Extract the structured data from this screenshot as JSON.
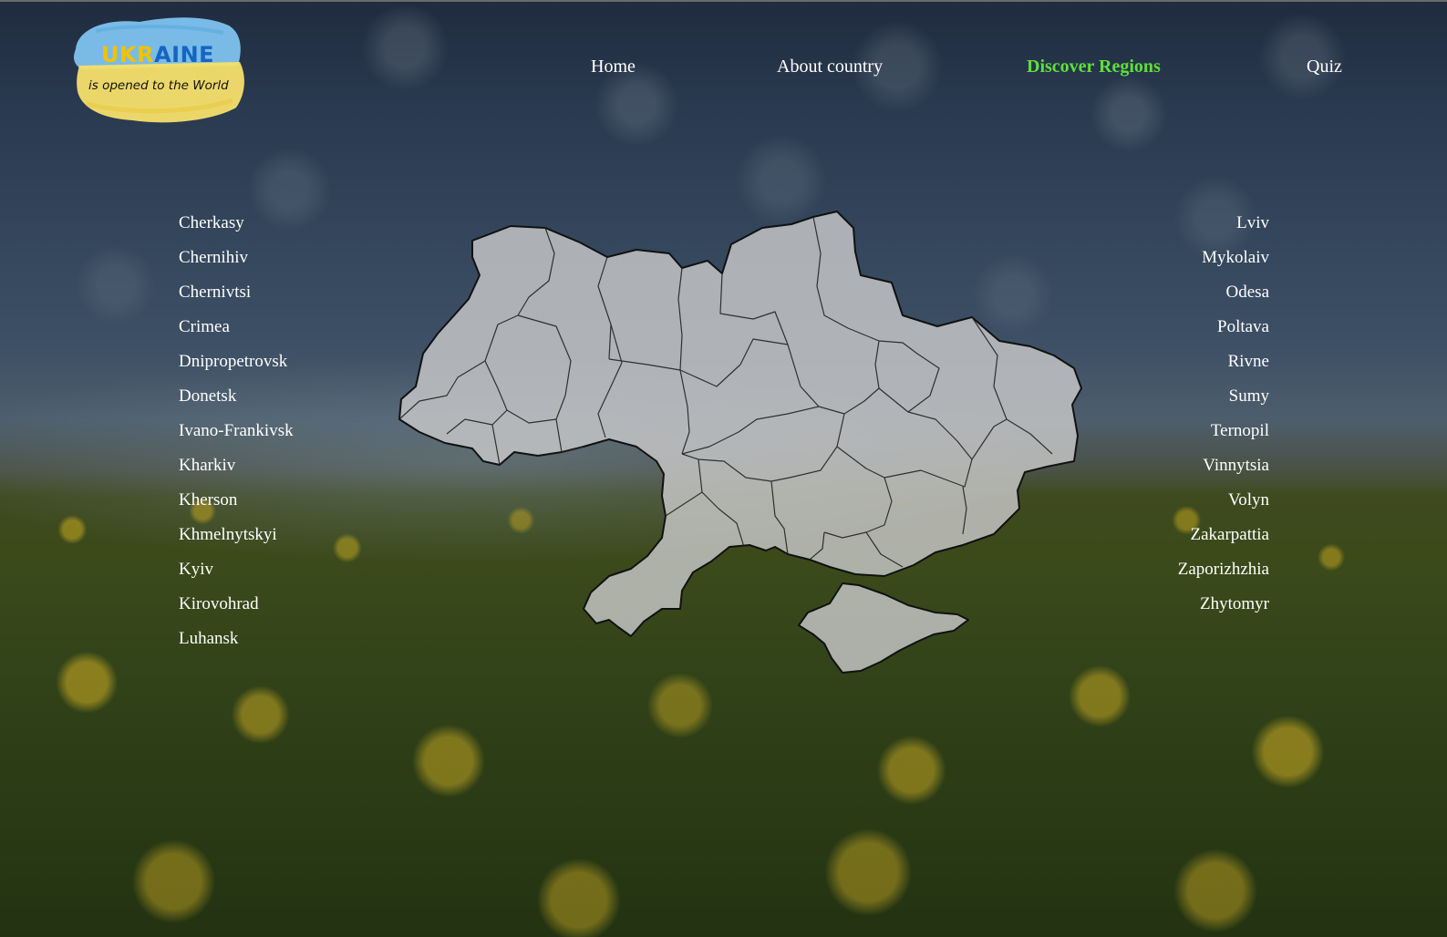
{
  "logo": {
    "title_blue": "UKR",
    "title_rest": "AINE",
    "tagline": "is opened to the World"
  },
  "nav": {
    "items": [
      {
        "label": "Home",
        "active": false
      },
      {
        "label": "About country",
        "active": false
      },
      {
        "label": "Discover Regions",
        "active": true
      },
      {
        "label": "Quiz",
        "active": false
      }
    ],
    "active_color": "#5ee03a"
  },
  "regions": {
    "left": [
      "Cherkasy",
      "Chernihiv",
      "Chernivtsi",
      "Crimea",
      "Dnipropetrovsk",
      "Donetsk",
      "Ivano-Frankivsk",
      "Kharkiv",
      "Kherson",
      "Khmelnytskyi",
      "Kyiv",
      "Kirovohrad",
      "Luhansk"
    ],
    "right": [
      "Lviv",
      "Mykolaiv",
      "Odesa",
      "Poltava",
      "Rivne",
      "Sumy",
      "Ternopil",
      "Vinnytsia",
      "Volyn",
      "Zakarpattia",
      "Zaporizhzhia",
      "Zhytomyr"
    ]
  },
  "map": {
    "fill": "#c8c8c8",
    "stroke": "#111111"
  }
}
